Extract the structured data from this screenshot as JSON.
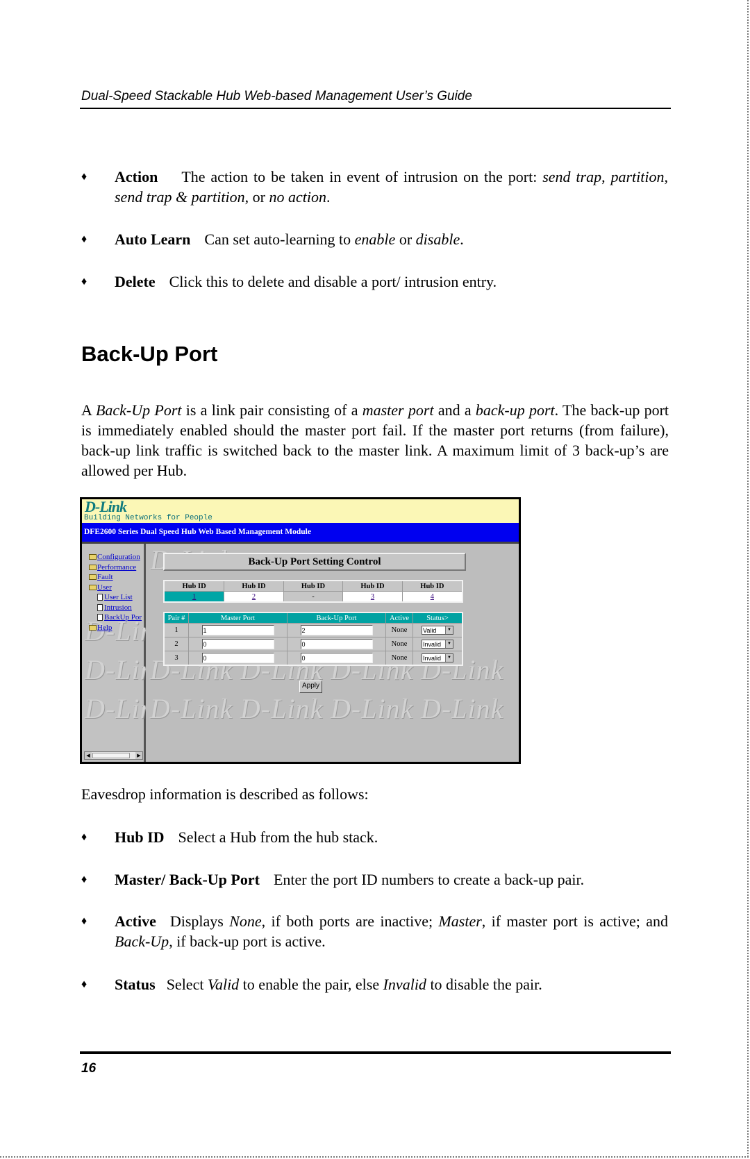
{
  "header": {
    "running_title": "Dual-Speed Stackable Hub Web-based Management User’s Guide"
  },
  "bullets_top": [
    {
      "term": "Action",
      "segments": [
        {
          "t": "The action to be taken in event of intrusion on the port:  ",
          "i": false
        },
        {
          "t": "send trap",
          "i": true
        },
        {
          "t": ", ",
          "i": false
        },
        {
          "t": "partition",
          "i": true
        },
        {
          "t": ", ",
          "i": false
        },
        {
          "t": "send trap & partition",
          "i": true
        },
        {
          "t": ", or ",
          "i": false
        },
        {
          "t": "no action",
          "i": true
        },
        {
          "t": ".",
          "i": false
        }
      ]
    },
    {
      "term": "Auto Learn",
      "segments": [
        {
          "t": "Can set auto-learning to ",
          "i": false
        },
        {
          "t": "enable",
          "i": true
        },
        {
          "t": " or ",
          "i": false
        },
        {
          "t": "disable",
          "i": true
        },
        {
          "t": ".",
          "i": false
        }
      ]
    },
    {
      "term": "Delete",
      "segments": [
        {
          "t": "Click this to delete and disable a port/ intrusion entry.",
          "i": false
        }
      ]
    }
  ],
  "section": {
    "heading": "Back-Up Port",
    "intro_segments": [
      {
        "t": "A ",
        "i": false
      },
      {
        "t": "Back-Up Port",
        "i": true
      },
      {
        "t": " is a link pair consisting of a ",
        "i": false
      },
      {
        "t": "master port",
        "i": true
      },
      {
        "t": " and a ",
        "i": false
      },
      {
        "t": "back-up port",
        "i": true
      },
      {
        "t": ".  The back-up port is immediately enabled should the master port fail.  If the master port returns (from failure), back-up link traffic is switched back to the master link.  A maximum limit of 3 back-up’s are allowed per Hub.",
        "i": false
      }
    ],
    "after_figure": "Eavesdrop information is described as follows:"
  },
  "screenshot": {
    "logo": "D-Link",
    "tagline": "Building Networks for People",
    "title": "DFE2600 Series Dual Speed Hub Web Based Management Module",
    "nav": [
      {
        "label": "Configuration",
        "type": "folder"
      },
      {
        "label": "Performance",
        "type": "folder"
      },
      {
        "label": "Fault",
        "type": "folder"
      },
      {
        "label": "User",
        "type": "folder-open"
      },
      {
        "label": "User List",
        "type": "doc"
      },
      {
        "label": "Intrusion",
        "type": "doc"
      },
      {
        "label": "BackUp Por",
        "type": "doc"
      },
      {
        "label": "Help",
        "type": "folder"
      }
    ],
    "watermark": "D-Link",
    "panel_title": "Back-Up Port Setting Control",
    "hub_header": "Hub ID",
    "hub_ids": [
      {
        "value": "1",
        "state": "selected"
      },
      {
        "value": "2",
        "state": "link"
      },
      {
        "value": "-",
        "state": "disabled"
      },
      {
        "value": "3",
        "state": "link"
      },
      {
        "value": "4",
        "state": "link"
      }
    ],
    "pair_columns": [
      "Pair #",
      "Master Port",
      "Back-Up Port",
      "Active",
      "Status>"
    ],
    "pairs": [
      {
        "pair": "1",
        "master": "1",
        "backup": "2",
        "active": "None",
        "status": "Valid"
      },
      {
        "pair": "2",
        "master": "0",
        "backup": "0",
        "active": "None",
        "status": "Invalid"
      },
      {
        "pair": "3",
        "master": "0",
        "backup": "0",
        "active": "None",
        "status": "Invalid"
      }
    ],
    "apply_label": "Apply",
    "colors": {
      "title_bar": "#0000f0",
      "banner": "#fbf7b6",
      "teal": "#00a2a2"
    }
  },
  "bullets_bottom": [
    {
      "term": "Hub ID",
      "segments": [
        {
          "t": "Select a Hub from the hub stack.",
          "i": false
        }
      ]
    },
    {
      "term": "Master/ Back-Up Port",
      "segments": [
        {
          "t": "Enter the port ID numbers to create a back-up pair.",
          "i": false
        }
      ]
    },
    {
      "term": "Active",
      "segments": [
        {
          "t": "Displays ",
          "i": false
        },
        {
          "t": "None",
          "i": true
        },
        {
          "t": ", if both ports are inactive; ",
          "i": false
        },
        {
          "t": "Master",
          "i": true
        },
        {
          "t": ", if master port is active; and ",
          "i": false
        },
        {
          "t": "Back-Up",
          "i": true
        },
        {
          "t": ", if back-up port is active.",
          "i": false
        }
      ]
    },
    {
      "term": "Status",
      "segments": [
        {
          "t": "Select ",
          "i": false
        },
        {
          "t": "Valid",
          "i": true
        },
        {
          "t": " to enable the pair, else ",
          "i": false
        },
        {
          "t": "Invalid",
          "i": true
        },
        {
          "t": " to disable the pair.",
          "i": false
        }
      ]
    }
  ],
  "footer": {
    "page_number": "16"
  }
}
